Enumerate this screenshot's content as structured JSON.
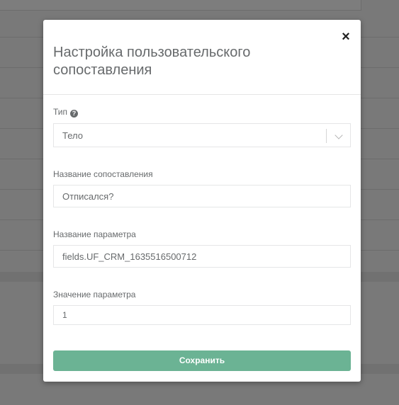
{
  "modal": {
    "title": "Настройка пользовательского сопоставления",
    "close_symbol": "×"
  },
  "fields": {
    "type": {
      "label": "Тип",
      "help_icon": "question-circle-icon",
      "value": "Тело"
    },
    "mapping_name": {
      "label": "Название сопоставления",
      "value": "Отписался?"
    },
    "param_name": {
      "label": "Название параметра",
      "value": "fields.UF_CRM_1635516500712"
    },
    "param_value": {
      "label": "Значение параметра",
      "value": "1"
    }
  },
  "actions": {
    "save_label": "Сохранить"
  },
  "colors": {
    "primary": "#6bb394",
    "text": "#676a6c",
    "border": "#e5e6e7"
  }
}
